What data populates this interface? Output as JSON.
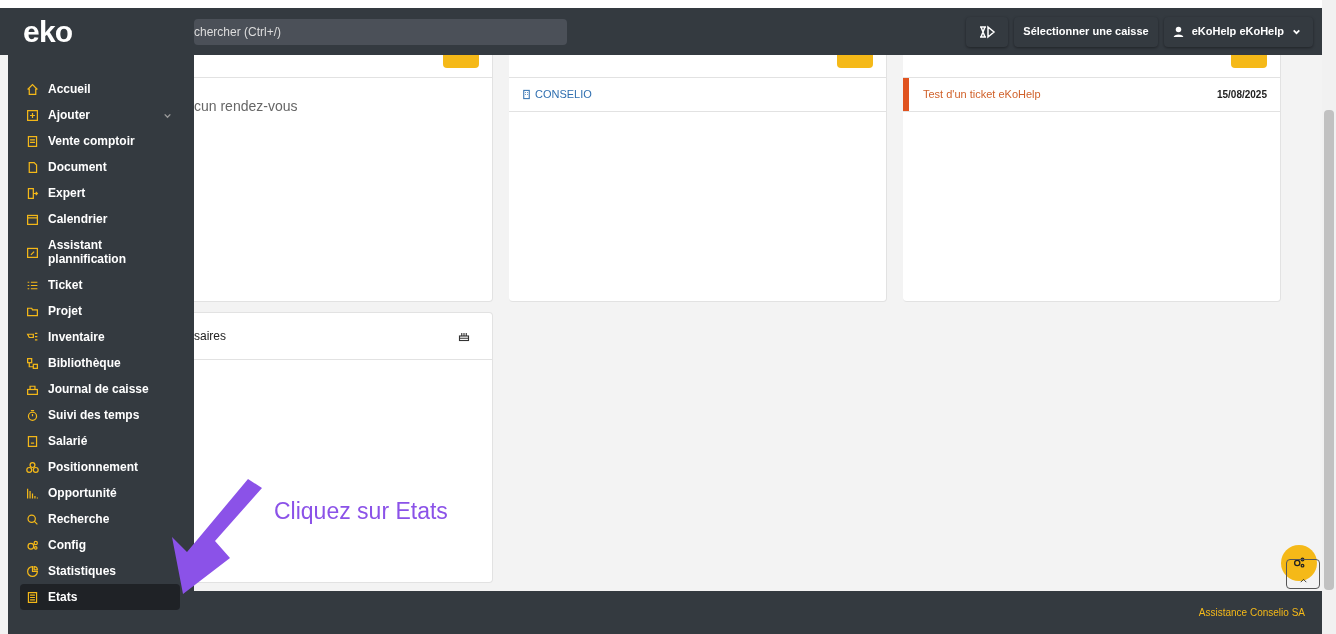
{
  "logo": "eko",
  "search": {
    "placeholder": "chercher (Ctrl+/)"
  },
  "navbar_buttons": [
    {
      "kind": "timer"
    },
    {
      "kind": "text",
      "label": "Sélectionner une caisse"
    },
    {
      "kind": "user",
      "label": "eKoHelp eKoHelp"
    }
  ],
  "sidebar": {
    "items": [
      {
        "label": "Accueil",
        "selected": false,
        "expandable": false
      },
      {
        "label": "Ajouter",
        "selected": false,
        "expandable": true
      },
      {
        "label": "Vente comptoir",
        "selected": false,
        "expandable": false
      },
      {
        "label": "Document",
        "selected": false,
        "expandable": false
      },
      {
        "label": "Expert",
        "selected": false,
        "expandable": false
      },
      {
        "label": "Calendrier",
        "selected": false,
        "expandable": false
      },
      {
        "label": "Assistant plannification",
        "selected": false,
        "expandable": false
      },
      {
        "label": "Ticket",
        "selected": false,
        "expandable": false
      },
      {
        "label": "Projet",
        "selected": false,
        "expandable": false
      },
      {
        "label": "Inventaire",
        "selected": false,
        "expandable": false
      },
      {
        "label": "Bibliothèque",
        "selected": false,
        "expandable": false
      },
      {
        "label": "Journal de caisse",
        "selected": false,
        "expandable": false
      },
      {
        "label": "Suivi des temps",
        "selected": false,
        "expandable": false
      },
      {
        "label": "Salarié",
        "selected": false,
        "expandable": false
      },
      {
        "label": "Positionnement",
        "selected": false,
        "expandable": false
      },
      {
        "label": "Opportunité",
        "selected": false,
        "expandable": false
      },
      {
        "label": "Recherche",
        "selected": false,
        "expandable": false
      },
      {
        "label": "Config",
        "selected": false,
        "expandable": false
      },
      {
        "label": "Statistiques",
        "selected": false,
        "expandable": false
      },
      {
        "label": "Etats",
        "selected": true,
        "expandable": false
      }
    ]
  },
  "cards": [
    {
      "empty_text": "cun rendez-vous"
    },
    {
      "memos": [
        {
          "label": "CONSELIO"
        }
      ]
    },
    {
      "tickets": [
        {
          "title": "Test d'un ticket eKoHelp",
          "date": "15/08/2025",
          "color": "#e0531f"
        }
      ]
    },
    {
      "title": "saires"
    }
  ],
  "annotation": {
    "text": "Cliquez sur Etats"
  },
  "footer": {
    "text": "Assistance Conselio SA"
  }
}
